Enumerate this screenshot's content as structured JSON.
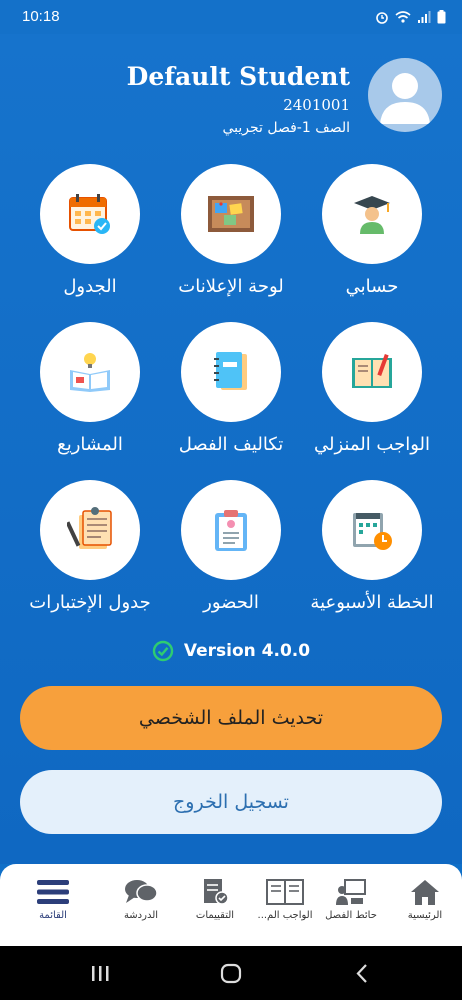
{
  "status": {
    "time": "10:18"
  },
  "profile": {
    "name": "Default Student",
    "id": "2401001",
    "class": "الصف 1-فصل تجريبي"
  },
  "tiles": [
    {
      "label": "حسابي",
      "icon": "graduate-icon"
    },
    {
      "label": "لوحة الإعلانات",
      "icon": "bulletin-board-icon"
    },
    {
      "label": "الجدول",
      "icon": "calendar-icon"
    },
    {
      "label": "الواجب المنزلي",
      "icon": "homework-book-icon"
    },
    {
      "label": "تكاليف الفصل",
      "icon": "notebook-icon"
    },
    {
      "label": "المشاريع",
      "icon": "project-idea-icon"
    },
    {
      "label": "الخطة الأسبوعية",
      "icon": "weekly-plan-icon"
    },
    {
      "label": "الحضور",
      "icon": "attendance-clipboard-icon"
    },
    {
      "label": "جدول الإختبارات",
      "icon": "exam-schedule-icon"
    }
  ],
  "version": "Version 4.0.0",
  "buttons": {
    "update_profile": "تحديث الملف الشخصي",
    "logout": "تسجيل الخروج"
  },
  "bottom_nav": [
    {
      "label": "الرئيسية",
      "icon": "home-icon"
    },
    {
      "label": "حائط الفصل",
      "icon": "class-wall-icon"
    },
    {
      "label": "الواجب الم...",
      "icon": "homework-icon"
    },
    {
      "label": "التقييمات",
      "icon": "evaluations-icon"
    },
    {
      "label": "الدردشة",
      "icon": "chat-icon"
    },
    {
      "label": "القائمة",
      "icon": "menu-icon"
    }
  ],
  "colors": {
    "primary": "#1471c9",
    "accent": "#f7a03c",
    "logout_bg": "#e4f0fb",
    "version_check": "#2ecc71"
  }
}
